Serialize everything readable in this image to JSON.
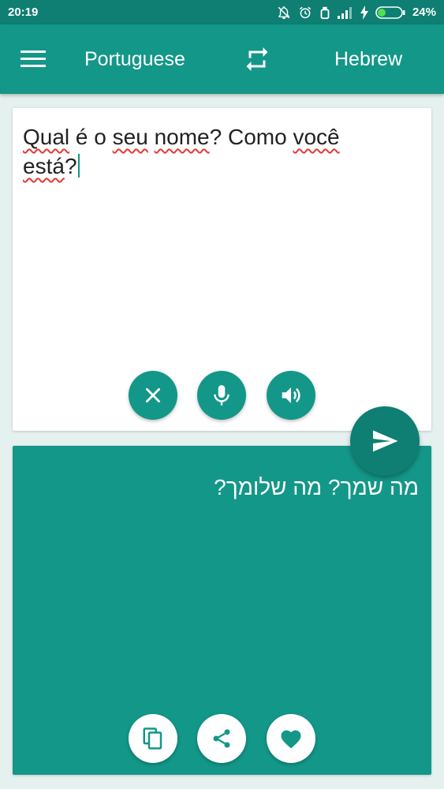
{
  "status_bar": {
    "time": "20:19",
    "battery": "24%",
    "icons": [
      "muted-bell-icon",
      "alarm-icon",
      "headset-icon",
      "signal-icon",
      "charging-icon",
      "battery-icon"
    ]
  },
  "toolbar": {
    "menu_icon": "hamburger-menu-icon",
    "source_language": "Portuguese",
    "swap_icon": "swap-arrows-icon",
    "target_language": "Hebrew"
  },
  "source": {
    "words": [
      "Qual",
      " é o ",
      "seu",
      " ",
      "nome",
      "? Como ",
      "você",
      "\n",
      "está",
      "?"
    ],
    "clear_icon": "close-icon",
    "mic_icon": "microphone-icon",
    "speaker_icon": "speaker-icon"
  },
  "send_icon": "send-icon",
  "target": {
    "text": "מה שמך? מה שלומך?",
    "copy_icon": "copy-icon",
    "share_icon": "share-icon",
    "favorite_icon": "heart-icon"
  },
  "colors": {
    "primary": "#139788",
    "primary_dark": "#0E7F72",
    "background": "#E5F1EF",
    "spellcheck": "#E53935"
  }
}
